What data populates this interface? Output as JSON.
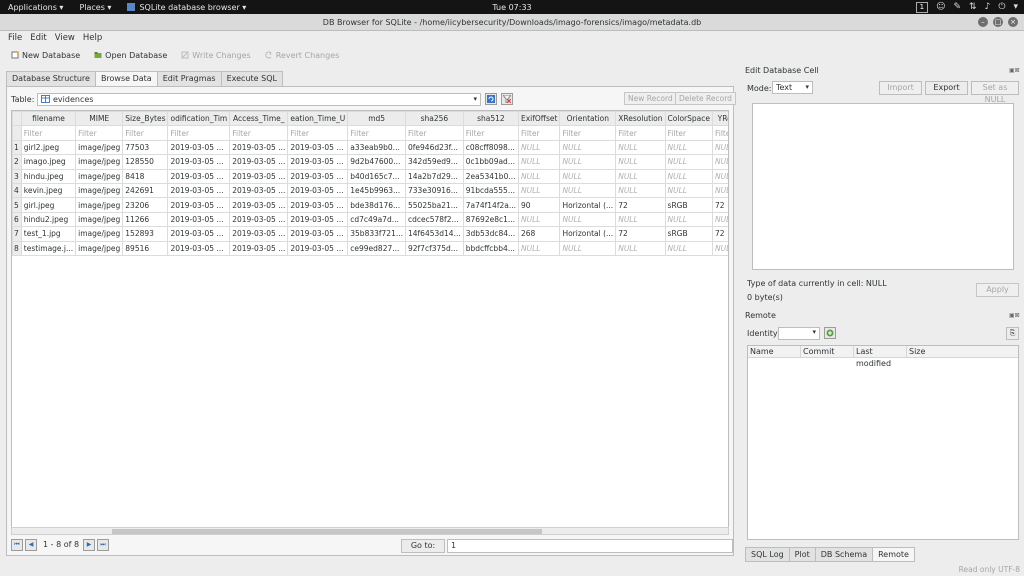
{
  "top_panel": {
    "applications": "Applications",
    "places": "Places",
    "app_name": "SQLite database browser",
    "clock": "Tue 07:33",
    "workspace": "1"
  },
  "window": {
    "title": "DB Browser for SQLite - /home/iicybersecurity/Downloads/imago-forensics/imago/metadata.db"
  },
  "menu": [
    "File",
    "Edit",
    "View",
    "Help"
  ],
  "toolbar": {
    "new_database": "New Database",
    "open_database": "Open Database",
    "write_changes": "Write Changes",
    "revert_changes": "Revert Changes"
  },
  "tabs": [
    "Database Structure",
    "Browse Data",
    "Edit Pragmas",
    "Execute SQL"
  ],
  "browse": {
    "table_label": "Table:",
    "table_name": "evidences",
    "new_record": "New Record",
    "delete_record": "Delete Record",
    "columns": [
      "filename",
      "MIME",
      "Size_Bytes",
      "odification_Tim",
      "Access_Time_",
      "eation_Time_U",
      "md5",
      "sha256",
      "sha512",
      "ExifOffset",
      "Orientation",
      "XResolution",
      "ColorSpace",
      "YRe"
    ],
    "filter_placeholder": "Filter",
    "rows": [
      [
        "girl2.jpeg",
        "image/jpeg",
        "77503",
        "2019-03-05 ...",
        "2019-03-05 ...",
        "2019-03-05 ...",
        "a33eab9b0...",
        "0fe946d23f...",
        "c08cff8098...",
        "NULL",
        "NULL",
        "NULL",
        "NULL",
        "NULL"
      ],
      [
        "imago.jpeg",
        "image/jpeg",
        "128550",
        "2019-03-05 ...",
        "2019-03-05 ...",
        "2019-03-05 ...",
        "9d2b47600...",
        "342d59ed9...",
        "0c1bb09ad...",
        "NULL",
        "NULL",
        "NULL",
        "NULL",
        "NULL"
      ],
      [
        "hindu.jpeg",
        "image/jpeg",
        "8418",
        "2019-03-05 ...",
        "2019-03-05 ...",
        "2019-03-05 ...",
        "b40d165c7...",
        "14a2b7d29...",
        "2ea5341b0...",
        "NULL",
        "NULL",
        "NULL",
        "NULL",
        "NULL"
      ],
      [
        "kevin.jpeg",
        "image/jpeg",
        "242691",
        "2019-03-05 ...",
        "2019-03-05 ...",
        "2019-03-05 ...",
        "1e45b9963...",
        "733e30916...",
        "91bcda555...",
        "NULL",
        "NULL",
        "NULL",
        "NULL",
        "NULL"
      ],
      [
        "girl.jpeg",
        "image/jpeg",
        "23206",
        "2019-03-05 ...",
        "2019-03-05 ...",
        "2019-03-05 ...",
        "bde38d176...",
        "55025ba21...",
        "7a74f14f2a...",
        "90",
        "Horizontal (...",
        "72",
        "sRGB",
        "72"
      ],
      [
        "hindu2.jpeg",
        "image/jpeg",
        "11266",
        "2019-03-05 ...",
        "2019-03-05 ...",
        "2019-03-05 ...",
        "cd7c49a7d...",
        "cdcec578f2...",
        "87692e8c1...",
        "NULL",
        "NULL",
        "NULL",
        "NULL",
        "NULL"
      ],
      [
        "test_1.jpg",
        "image/jpeg",
        "152893",
        "2019-03-05 ...",
        "2019-03-05 ...",
        "2019-03-05 ...",
        "35b833f721...",
        "14f6453d14...",
        "3db53dc84...",
        "268",
        "Horizontal (...",
        "72",
        "sRGB",
        "72"
      ],
      [
        "testimage.j...",
        "image/jpeg",
        "89516",
        "2019-03-05 ...",
        "2019-03-05 ...",
        "2019-03-05 ...",
        "ce99ed827...",
        "92f7cf375d...",
        "bbdcffcbb4...",
        "NULL",
        "NULL",
        "NULL",
        "NULL",
        "NULL"
      ]
    ],
    "page_info": "1 - 8 of 8",
    "goto_label": "Go to:",
    "goto_value": "1"
  },
  "edit_cell": {
    "title": "Edit Database Cell",
    "mode_label": "Mode:",
    "mode_value": "Text",
    "import": "Import",
    "export": "Export",
    "set_as_null": "Set as NULL",
    "type_info": "Type of data currently in cell: NULL",
    "size_info": "0 byte(s)",
    "apply": "Apply"
  },
  "remote": {
    "title": "Remote",
    "identity_label": "Identity",
    "columns": [
      "Name",
      "Commit",
      "Last modified",
      "Size"
    ]
  },
  "bottom_tabs": [
    "SQL Log",
    "Plot",
    "DB Schema",
    "Remote"
  ],
  "status": "Read only  UTF-8"
}
